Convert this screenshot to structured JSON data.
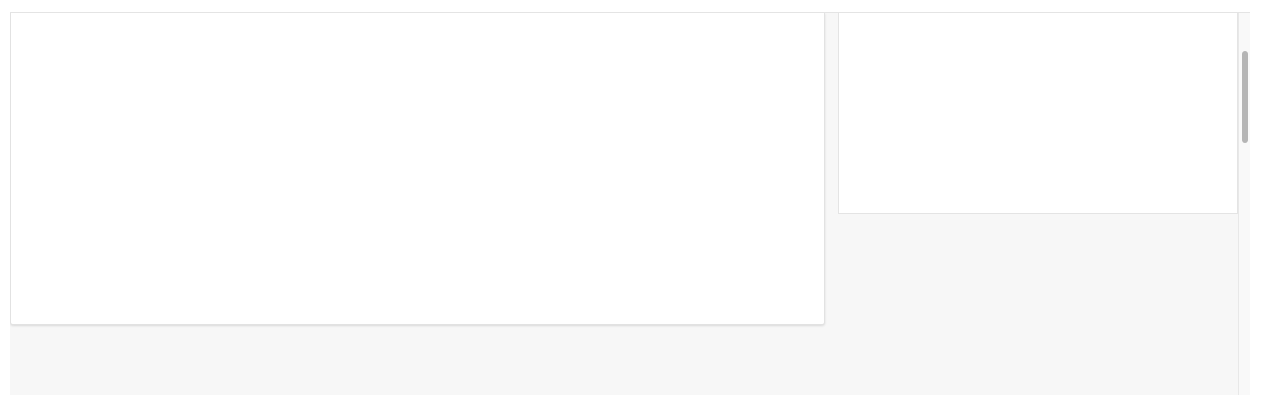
{
  "page": {
    "main_panel": {},
    "side_panel": {},
    "scrollbar": {
      "scroll_position": 0.1
    }
  },
  "colors": {
    "page_background": "#f7f7f7",
    "card_background": "#ffffff",
    "border": "#e2e2e2",
    "scrollbar_thumb": "#b5b5b5"
  }
}
